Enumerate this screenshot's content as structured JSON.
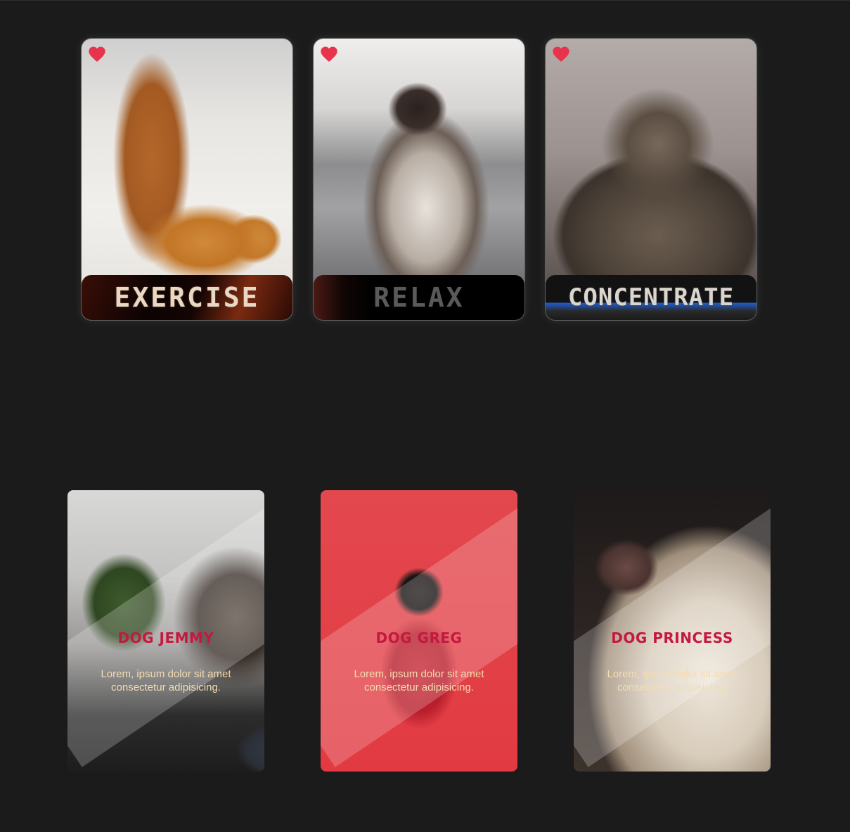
{
  "cats": [
    {
      "title": "EXERCISE",
      "heart": "heart-icon"
    },
    {
      "title": "RELAX",
      "heart": "heart-icon"
    },
    {
      "title": "CONCENTRATE",
      "heart": "heart-icon"
    }
  ],
  "dogs": [
    {
      "title": "DOG JEMMY",
      "description": "Lorem, ipsum dolor sit amet consectetur adipisicing."
    },
    {
      "title": "DOG GREG",
      "description": "Lorem, ipsum dolor sit amet consectetur adipisicing."
    },
    {
      "title": "DOG PRINCESS",
      "description": "Lorem, ipsum dolor sit amet consectetur adipisicing."
    }
  ],
  "colors": {
    "background": "#1b1b1b",
    "heart": "#e8334d",
    "dog_title": "#c5183f",
    "dog_text": "#f3dcb0"
  }
}
